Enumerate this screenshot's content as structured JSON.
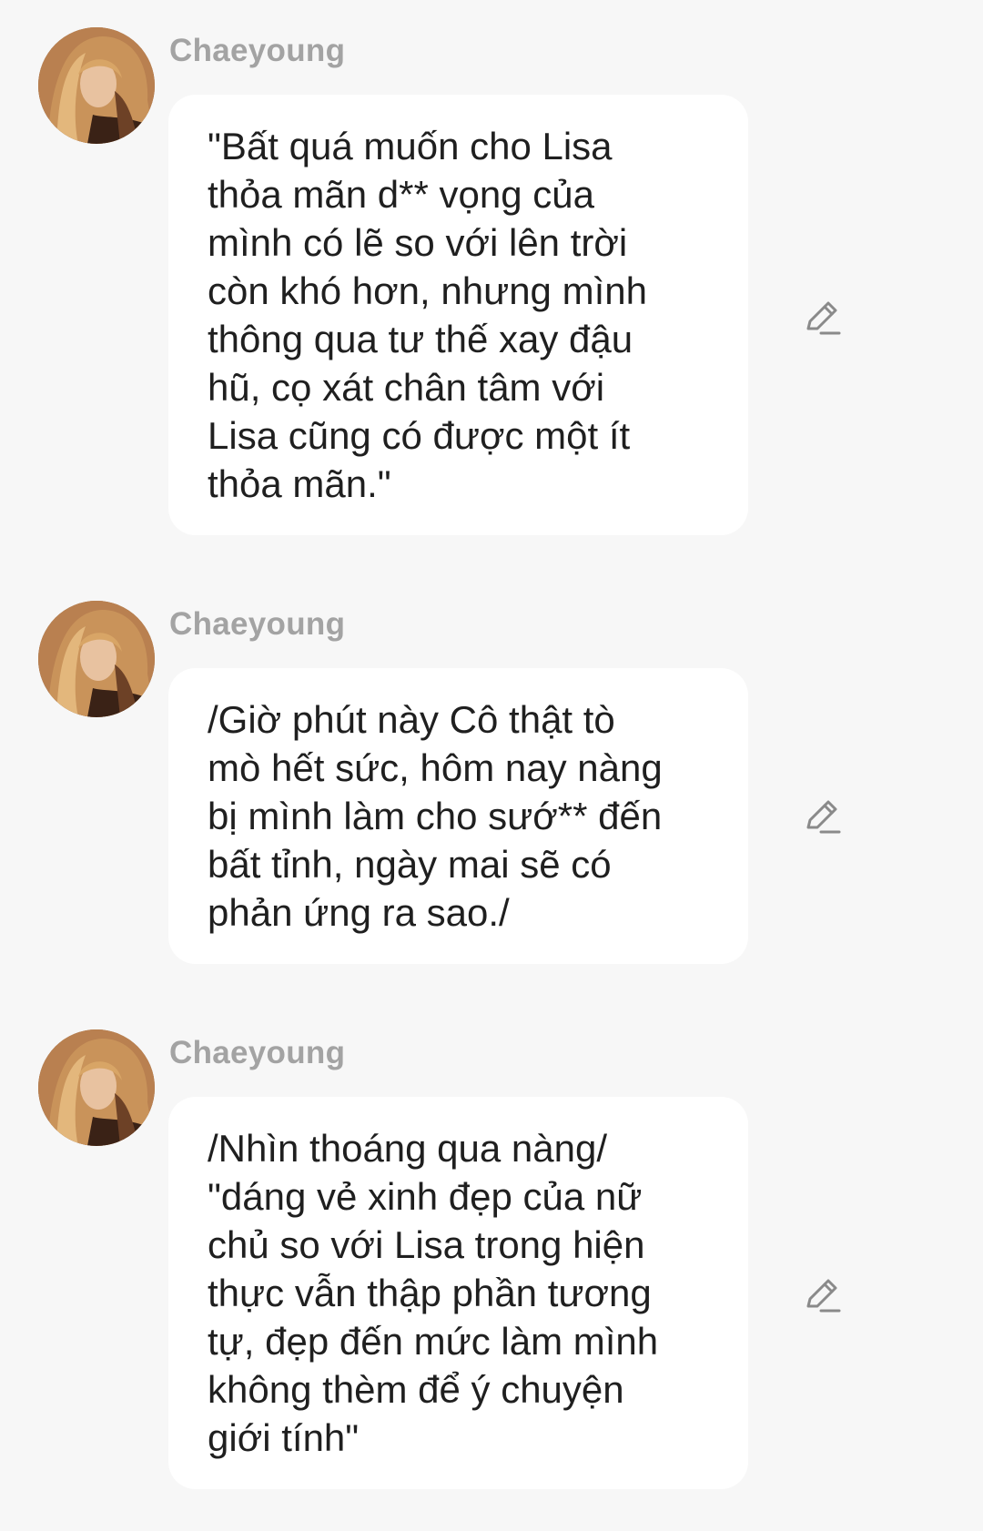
{
  "colors": {
    "background": "#f7f7f7",
    "bubble": "#ffffff",
    "sender_name": "#a3a3a3",
    "message_text": "#1f1f1f",
    "edit_icon": "#8a8a8a"
  },
  "messages": [
    {
      "sender": "Chaeyoung",
      "avatar_icon": "profile-photo",
      "text": "\"Bất quá muốn cho Lisa\nthỏa mãn d** vọng của\nmình có lẽ so với lên trời\ncòn khó hơn, nhưng mình\nthông qua tư thế xay đậu\nhũ, cọ xát chân tâm với\nLisa cũng có được một ít\nthỏa mãn.\"",
      "action_icon": "edit-pencil-icon"
    },
    {
      "sender": "Chaeyoung",
      "avatar_icon": "profile-photo",
      "text": "/Giờ phút này Cô thật tò\nmò hết sức, hôm nay nàng\nbị mình làm cho sướ** đến\nbất tỉnh, ngày mai sẽ có\nphản ứng ra sao./",
      "action_icon": "edit-pencil-icon"
    },
    {
      "sender": "Chaeyoung",
      "avatar_icon": "profile-photo",
      "text": "/Nhìn thoáng qua nàng/\n\"dáng vẻ xinh đẹp của nữ\nchủ so với Lisa trong hiện\nthực vẫn thập phần tương\ntự, đẹp đến mức làm mình\nkhông thèm để ý chuyện\ngiới tính\"",
      "action_icon": "edit-pencil-icon"
    }
  ]
}
